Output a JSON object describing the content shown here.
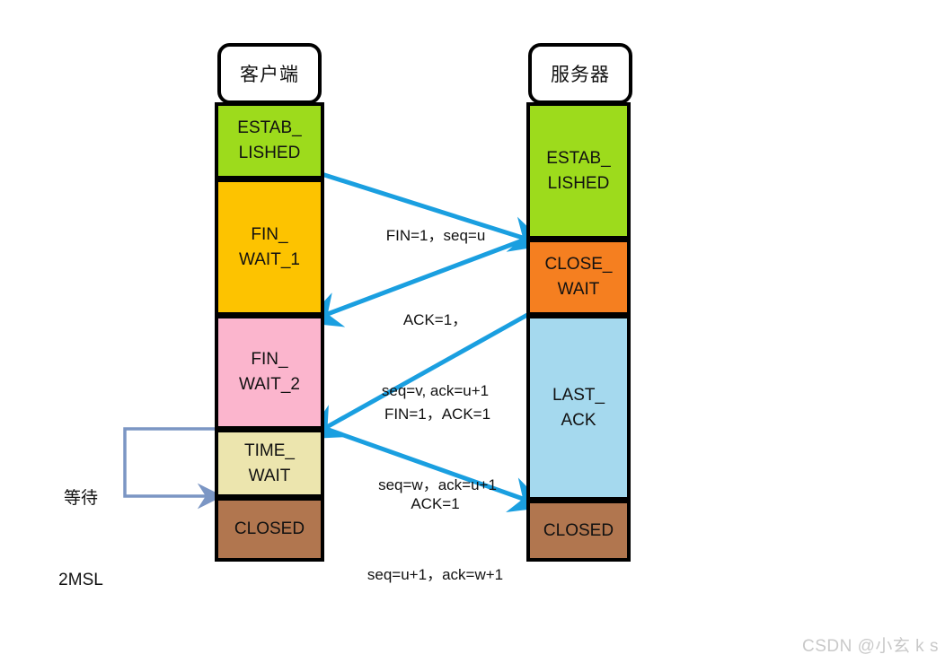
{
  "diagram": {
    "title": "TCP four-way handshake connection termination",
    "colors": {
      "arrow": "#1a9fe0",
      "bracket": "#7b96c4",
      "border": "#000000",
      "established": "#9ddb1c",
      "fin_wait_1": "#fdc300",
      "fin_wait_2": "#fbb5cd",
      "time_wait": "#ece5ae",
      "closed": "#b1764f",
      "close_wait": "#f57f20",
      "last_ack": "#a5d9ee",
      "title_box": "#ffffff",
      "watermark": "#c9c9c9"
    },
    "client": {
      "title": "客户端",
      "states": [
        {
          "id": "established",
          "lines": [
            "ESTAB_",
            "LISHED"
          ]
        },
        {
          "id": "fin-wait-1",
          "lines": [
            "FIN_",
            "WAIT_1"
          ]
        },
        {
          "id": "fin-wait-2",
          "lines": [
            "FIN_",
            "WAIT_2"
          ]
        },
        {
          "id": "time-wait",
          "lines": [
            "TIME_",
            "WAIT"
          ]
        },
        {
          "id": "closed",
          "lines": [
            "CLOSED"
          ]
        }
      ]
    },
    "server": {
      "title": "服务器",
      "states": [
        {
          "id": "established",
          "lines": [
            "ESTAB_",
            "LISHED"
          ]
        },
        {
          "id": "close-wait",
          "lines": [
            "CLOSE_",
            "WAIT"
          ]
        },
        {
          "id": "last-ack",
          "lines": [
            "LAST_",
            "ACK"
          ]
        },
        {
          "id": "closed",
          "lines": [
            "CLOSED"
          ]
        }
      ]
    },
    "messages": [
      {
        "id": "fin-seq-u",
        "direction": "client-to-server",
        "lines": [
          "FIN=1，seq=u"
        ]
      },
      {
        "id": "ack-seq-v",
        "direction": "server-to-client",
        "lines": [
          "ACK=1，",
          "seq=v, ack=u+1"
        ]
      },
      {
        "id": "fin-ack-seq-w",
        "direction": "server-to-client",
        "lines": [
          "FIN=1，ACK=1",
          "seq=w，ack=u+1"
        ]
      },
      {
        "id": "ack-seq-u1",
        "direction": "client-to-server",
        "lines": [
          "ACK=1",
          "seq=u+1，ack=w+1"
        ]
      }
    ],
    "wait_annotation": {
      "lines": [
        "等待",
        "2MSL"
      ]
    },
    "watermark": "CSDN @小玄 k s"
  }
}
